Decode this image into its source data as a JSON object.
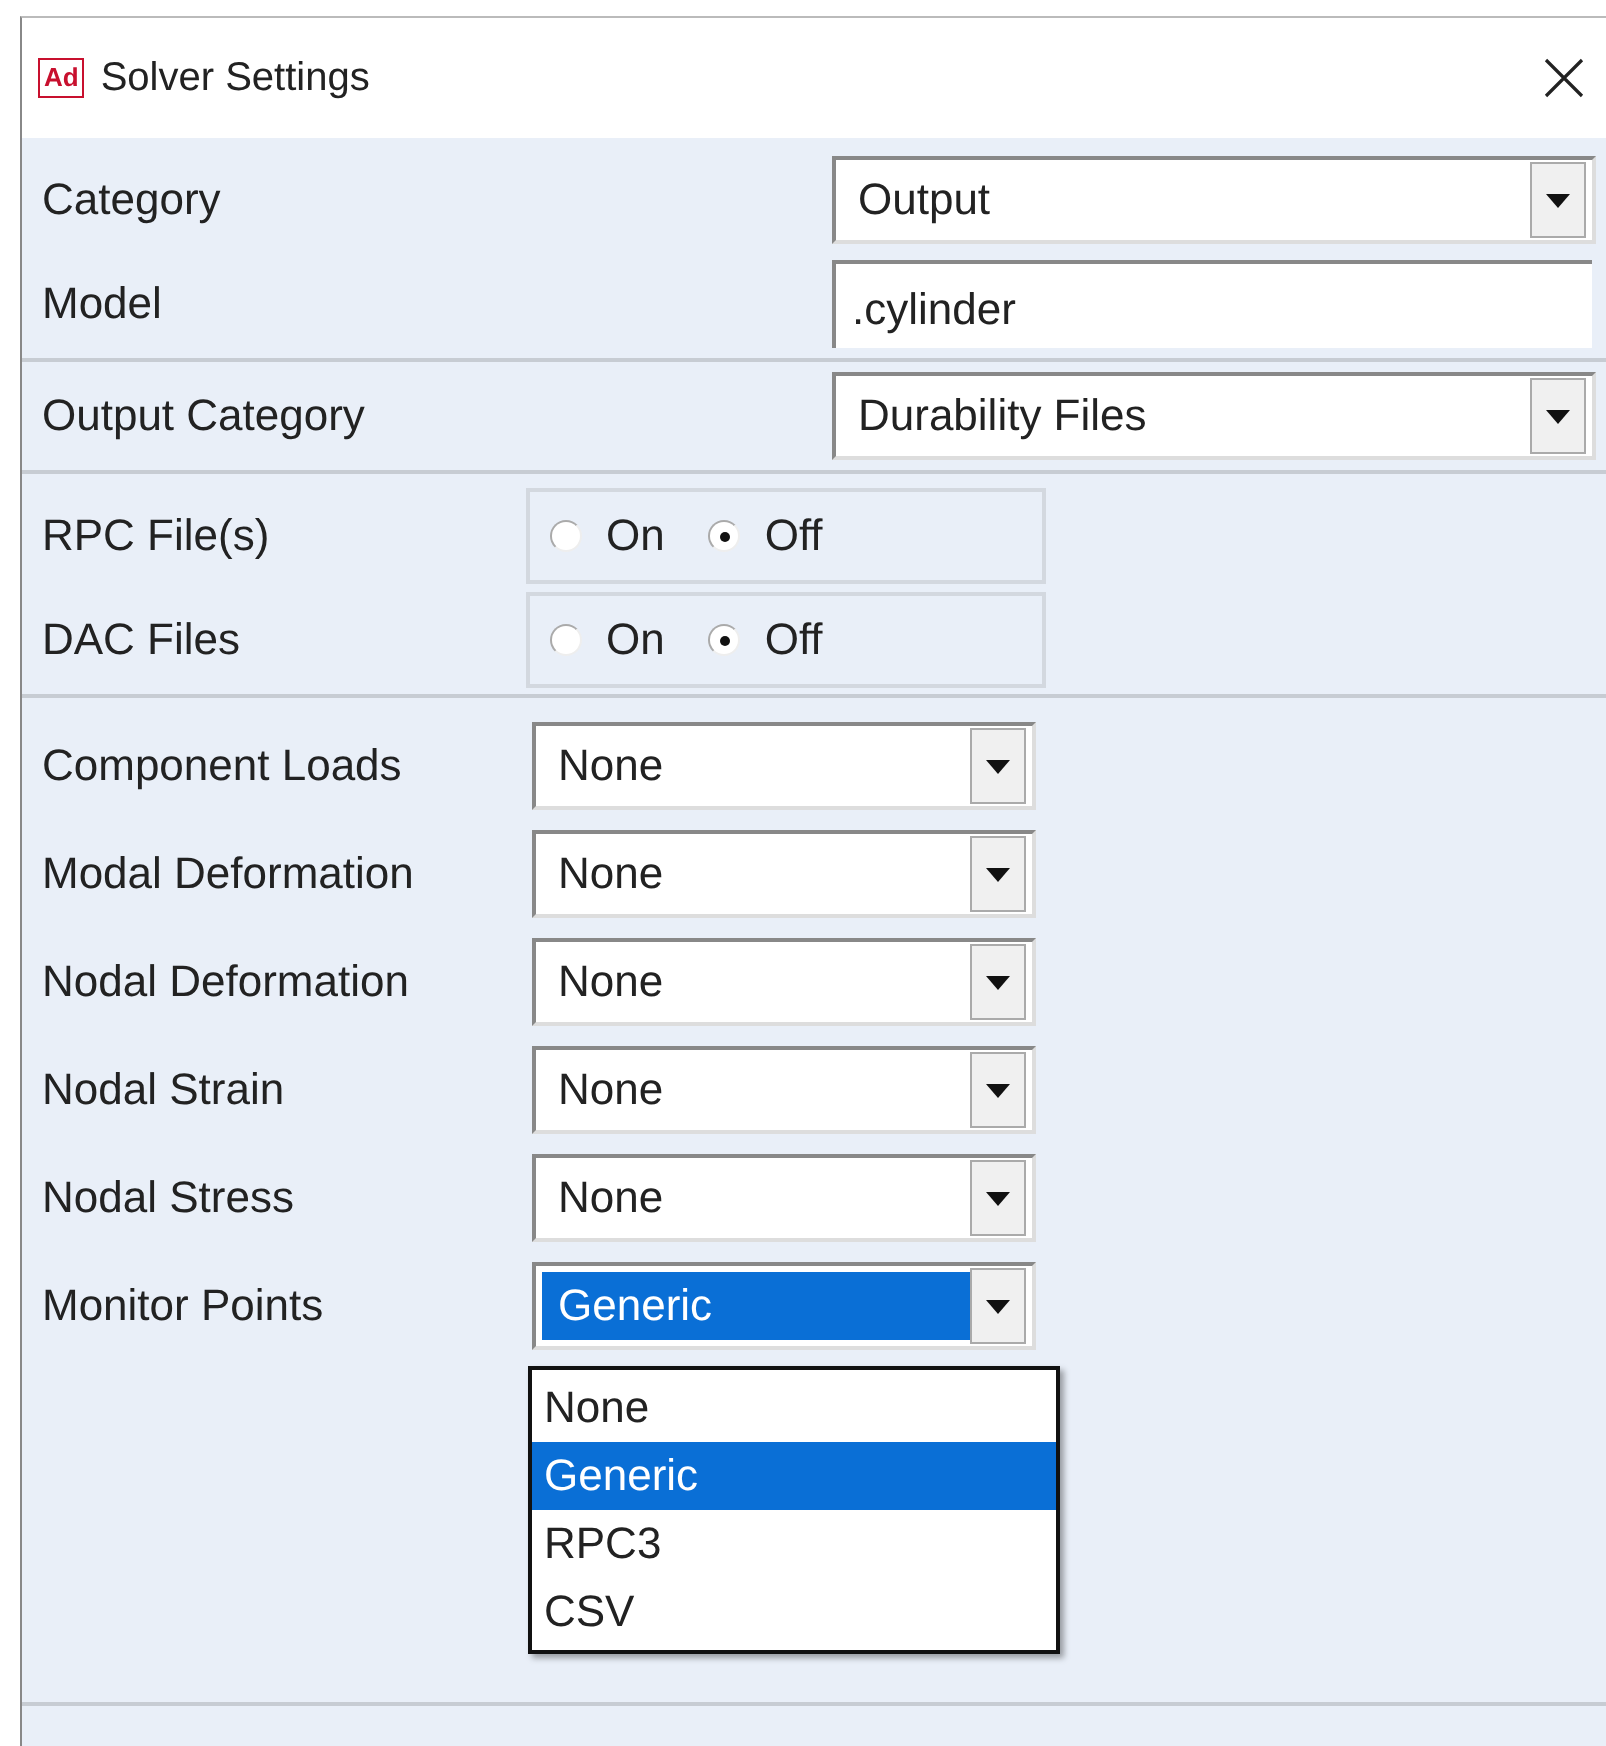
{
  "window": {
    "app_badge": "Ad",
    "title": "Solver Settings"
  },
  "top_fields": [
    {
      "label": "Category",
      "kind": "select",
      "value": "Output"
    },
    {
      "label": "Model",
      "kind": "text",
      "value": ".cylinder"
    }
  ],
  "output_category": {
    "label": "Output Category",
    "value": "Durability Files"
  },
  "toggles": [
    {
      "label": "RPC File(s)",
      "options": [
        {
          "label": "On",
          "selected": false
        },
        {
          "label": "Off",
          "selected": true
        }
      ]
    },
    {
      "label": "DAC Files",
      "options": [
        {
          "label": "On",
          "selected": false
        },
        {
          "label": "Off",
          "selected": true
        }
      ]
    }
  ],
  "outputs": [
    {
      "label": "Component Loads",
      "value": "None",
      "focused": false
    },
    {
      "label": "Modal Deformation",
      "value": "None",
      "focused": false
    },
    {
      "label": "Nodal Deformation",
      "value": "None",
      "focused": false
    },
    {
      "label": "Nodal Strain",
      "value": "None",
      "focused": false
    },
    {
      "label": "Nodal Stress",
      "value": "None",
      "focused": false
    },
    {
      "label": "Monitor Points",
      "value": "Generic",
      "focused": true,
      "options": [
        {
          "label": "None",
          "selected": false
        },
        {
          "label": "Generic",
          "selected": true
        },
        {
          "label": "RPC3",
          "selected": false
        },
        {
          "label": "CSV",
          "selected": false
        }
      ]
    }
  ]
}
